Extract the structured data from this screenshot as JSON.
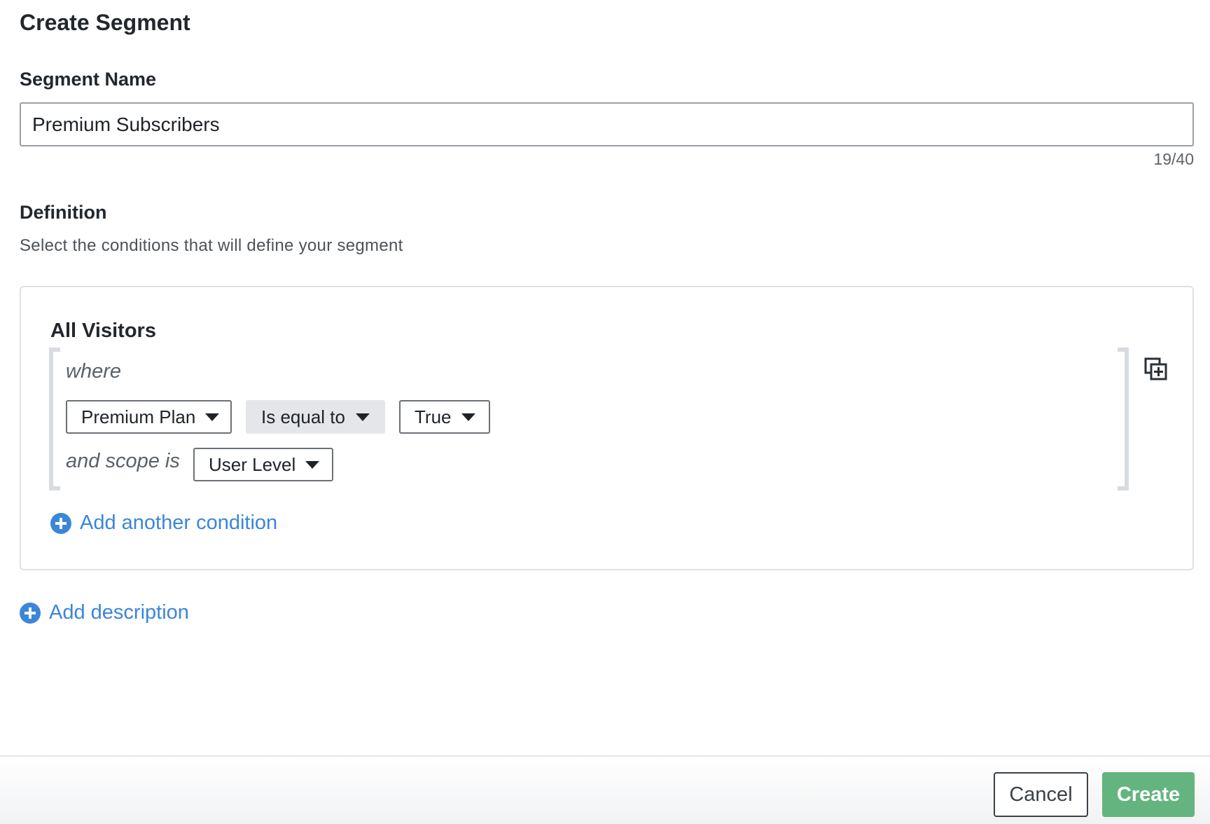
{
  "dialog": {
    "title": "Create Segment"
  },
  "segment_name": {
    "label": "Segment Name",
    "value": "Premium Subscribers",
    "char_count": "19/40"
  },
  "definition": {
    "title": "Definition",
    "subtitle": "Select the conditions that will define your segment",
    "group_label": "All Visitors",
    "where_label": "where",
    "condition": {
      "attribute": "Premium Plan",
      "operator": "Is equal to",
      "value": "True"
    },
    "scope_label": "and scope is",
    "scope_value": "User Level",
    "copy_icon": "copy-plus-icon",
    "add_condition_label": "Add another condition"
  },
  "add_description_label": "Add description",
  "footer": {
    "cancel_label": "Cancel",
    "create_label": "Create"
  },
  "colors": {
    "link": "#3b86d8",
    "primary_button": "#64b47f",
    "operator_fill": "#e4e6ea"
  }
}
